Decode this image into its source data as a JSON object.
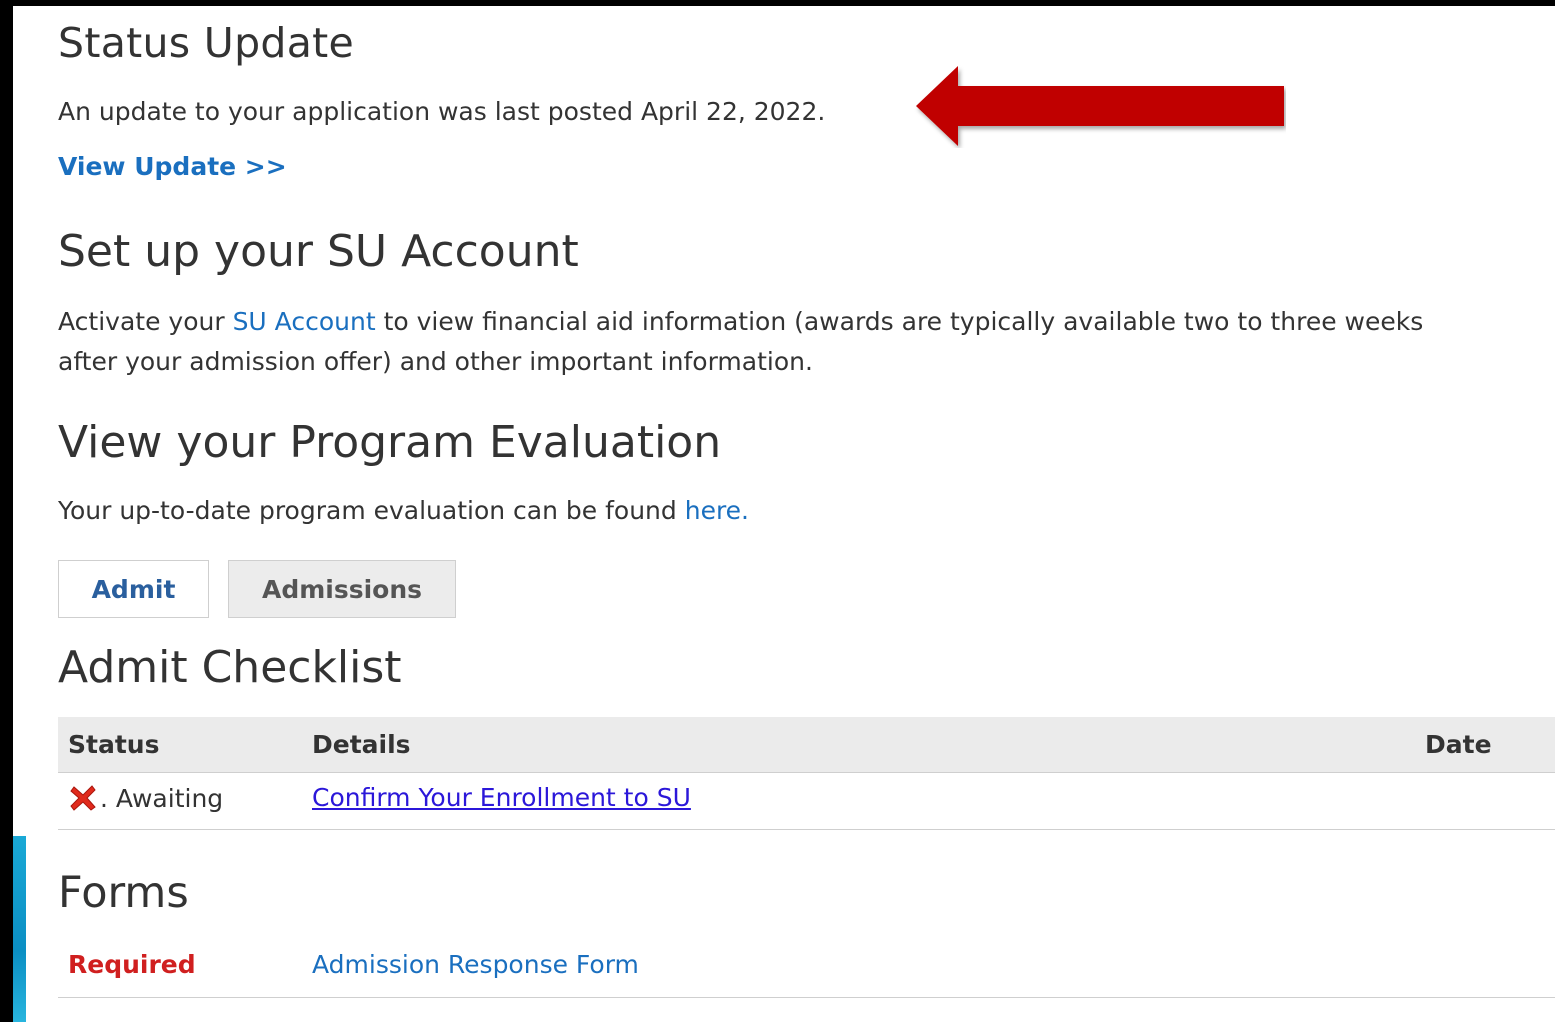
{
  "status_update": {
    "heading": "Status Update",
    "text": "An update to your application was last posted April 22, 2022.",
    "view_update_link": "View Update >>"
  },
  "su_account": {
    "heading": "Set up your SU Account",
    "text_before": "Activate your ",
    "link": "SU Account",
    "text_after_line1": " to view financial aid information (awards are typically available two to three weeks",
    "text_line2": "after your admission offer) and other important information."
  },
  "program_evaluation": {
    "heading": "View your Program Evaluation",
    "text": "Your up-to-date program evaluation can be found ",
    "link": "here."
  },
  "tabs": [
    {
      "label": "Admit",
      "active": true
    },
    {
      "label": "Admissions",
      "active": false
    }
  ],
  "admit_checklist": {
    "heading": "Admit Checklist",
    "columns": [
      "Status",
      "Details",
      "Date"
    ],
    "rows": [
      {
        "status_icon": "red-x-icon",
        "status": ". Awaiting",
        "details": "Confirm Your Enrollment to SU",
        "date": ""
      }
    ]
  },
  "forms": {
    "heading": "Forms",
    "rows": [
      {
        "requirement": "Required",
        "form": "Admission Response Form"
      }
    ]
  },
  "annotation": {
    "arrow_icon": "red-arrow-icon",
    "arrow_color": "#c00000"
  },
  "colors": {
    "link": "#1a6fbf",
    "required": "#d01f1f",
    "visited_link": "#2b17d9"
  }
}
